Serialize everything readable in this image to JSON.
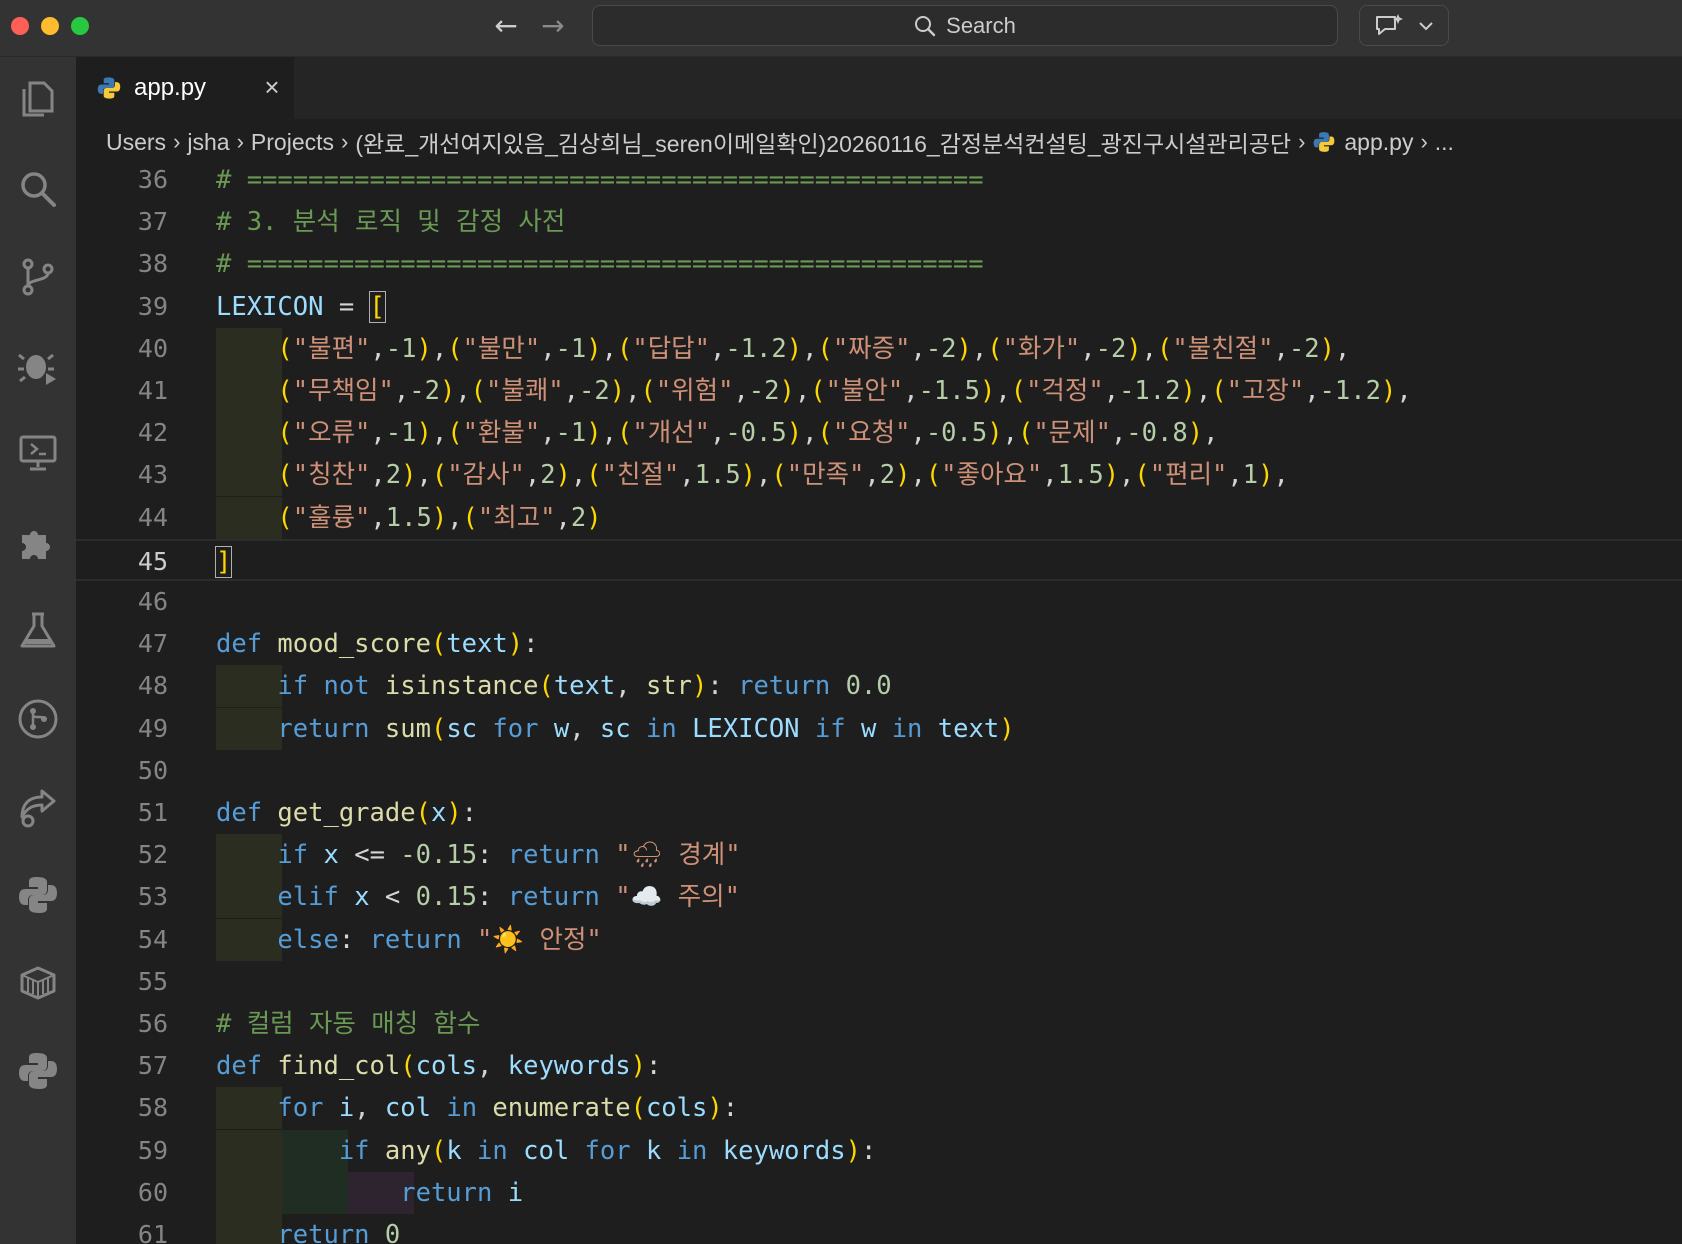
{
  "titlebar": {
    "search_placeholder": "Search",
    "back_icon": "arrow-left-icon",
    "forward_icon": "arrow-right-icon"
  },
  "activity_bar": {
    "items": [
      "explorer-icon",
      "search-icon",
      "source-control-icon",
      "run-debug-icon",
      "remote-explorer-icon",
      "extensions-icon",
      "testing-icon",
      "git-graph-icon",
      "live-share-icon",
      "python-icon",
      "containers-icon",
      "python-env-icon"
    ]
  },
  "tab": {
    "label": "app.py",
    "close": "×"
  },
  "breadcrumb": {
    "items": [
      "Users",
      "jsha",
      "Projects",
      "(완료_개선여지있음_김상희님_seren이메일확인)20260116_감정분석컨설팅_광진구시설관리공단",
      "app.py",
      "..."
    ]
  },
  "editor": {
    "active_line": 45,
    "lines": [
      {
        "n": "36",
        "text": "# ================================================"
      },
      {
        "n": "37",
        "text": "# 3. 분석 로직 및 감정 사전"
      },
      {
        "n": "38",
        "text": "# ================================================"
      },
      {
        "n": "39",
        "text": "LEXICON = ["
      },
      {
        "n": "40",
        "text": "    (\"불편\",-1),(\"불만\",-1),(\"답답\",-1.2),(\"짜증\",-2),(\"화가\",-2),(\"불친절\",-2),"
      },
      {
        "n": "41",
        "text": "    (\"무책임\",-2),(\"불쾌\",-2),(\"위험\",-2),(\"불안\",-1.5),(\"걱정\",-1.2),(\"고장\",-1.2),"
      },
      {
        "n": "42",
        "text": "    (\"오류\",-1),(\"환불\",-1),(\"개선\",-0.5),(\"요청\",-0.5),(\"문제\",-0.8),"
      },
      {
        "n": "43",
        "text": "    (\"칭찬\",2),(\"감사\",2),(\"친절\",1.5),(\"만족\",2),(\"좋아요\",1.5),(\"편리\",1),"
      },
      {
        "n": "44",
        "text": "    (\"훌륭\",1.5),(\"최고\",2)"
      },
      {
        "n": "45",
        "text": "]"
      },
      {
        "n": "46",
        "text": ""
      },
      {
        "n": "47",
        "text": "def mood_score(text):"
      },
      {
        "n": "48",
        "text": "    if not isinstance(text, str): return 0.0"
      },
      {
        "n": "49",
        "text": "    return sum(sc for w, sc in LEXICON if w in text)"
      },
      {
        "n": "50",
        "text": ""
      },
      {
        "n": "51",
        "text": "def get_grade(x):"
      },
      {
        "n": "52",
        "text": "    if x <= -0.15: return \"🌧 경계\""
      },
      {
        "n": "53",
        "text": "    elif x < 0.15: return \"☁️ 주의\""
      },
      {
        "n": "54",
        "text": "    else: return \"☀️ 안정\""
      },
      {
        "n": "55",
        "text": ""
      },
      {
        "n": "56",
        "text": "# 컬럼 자동 매칭 함수"
      },
      {
        "n": "57",
        "text": "def find_col(cols, keywords):"
      },
      {
        "n": "58",
        "text": "    for i, col in enumerate(cols):"
      },
      {
        "n": "59",
        "text": "        if any(k in col for k in keywords):"
      },
      {
        "n": "60",
        "text": "            return i"
      },
      {
        "n": "61",
        "text": "    return 0"
      }
    ]
  }
}
